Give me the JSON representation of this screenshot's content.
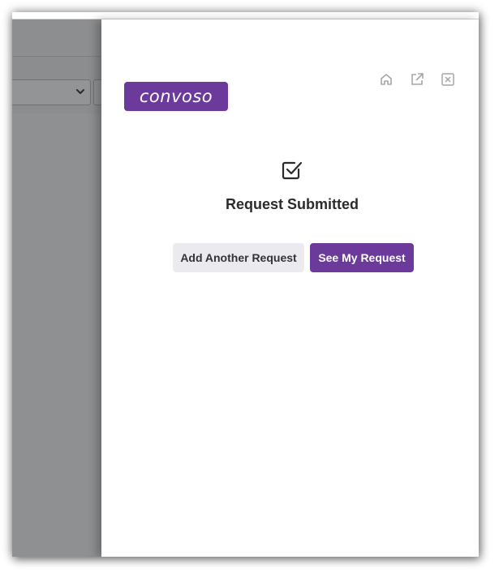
{
  "colors": {
    "brand_purple": "#6b3a9a",
    "icon_gray": "#a6a6a6",
    "title_text": "#2b2b2b",
    "secondary_button_bg": "#ebebef"
  },
  "header": {
    "logo_text": "convoso",
    "icons": [
      "home-icon",
      "external-link-icon",
      "close-icon"
    ]
  },
  "status": {
    "icon": "checkbox-checked-icon",
    "title": "Request Submitted"
  },
  "actions": {
    "add_another_label": "Add Another Request",
    "see_my_request_label": "See My Request"
  }
}
